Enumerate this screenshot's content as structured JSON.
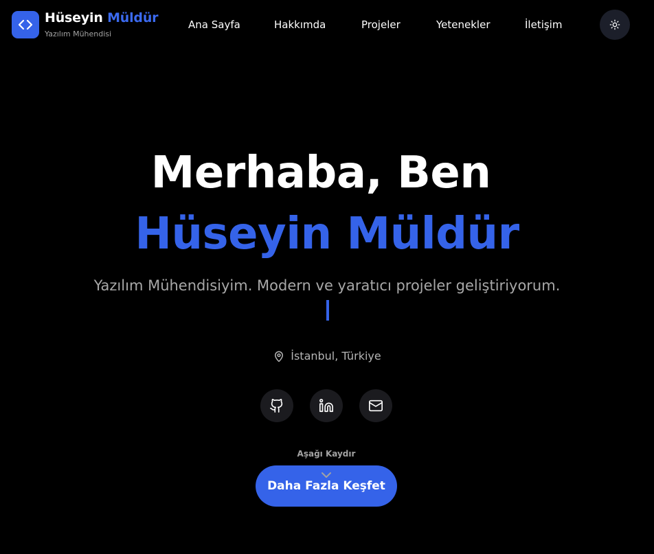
{
  "header": {
    "brand_first": "Hüseyin",
    "brand_last": "Müldür",
    "brand_subtitle": "Yazılım Mühendisi",
    "nav": [
      {
        "label": "Ana Sayfa"
      },
      {
        "label": "Hakkımda"
      },
      {
        "label": "Projeler"
      },
      {
        "label": "Yetenekler"
      },
      {
        "label": "İletişim"
      }
    ],
    "logo_icon": "code-icon",
    "theme_icon": "sun-icon"
  },
  "hero": {
    "greeting": "Merhaba, Ben",
    "name": "Hüseyin Müldür",
    "tagline": "Yazılım Mühendisiyim. Modern ve yaratıcı projeler geliştiriyorum.",
    "location": "İstanbul, Türkiye",
    "location_icon": "map-pin-icon",
    "socials": [
      {
        "icon": "github-icon"
      },
      {
        "icon": "linkedin-icon"
      },
      {
        "icon": "mail-icon"
      }
    ],
    "scroll_label": "Aşağı Kaydır",
    "cta_label": "Daha Fazla Keşfet"
  },
  "colors": {
    "background": "#000000",
    "accent": "#3563e9",
    "muted_text": "#a8a8a8",
    "icon_button_bg": "#1b1b1f"
  }
}
